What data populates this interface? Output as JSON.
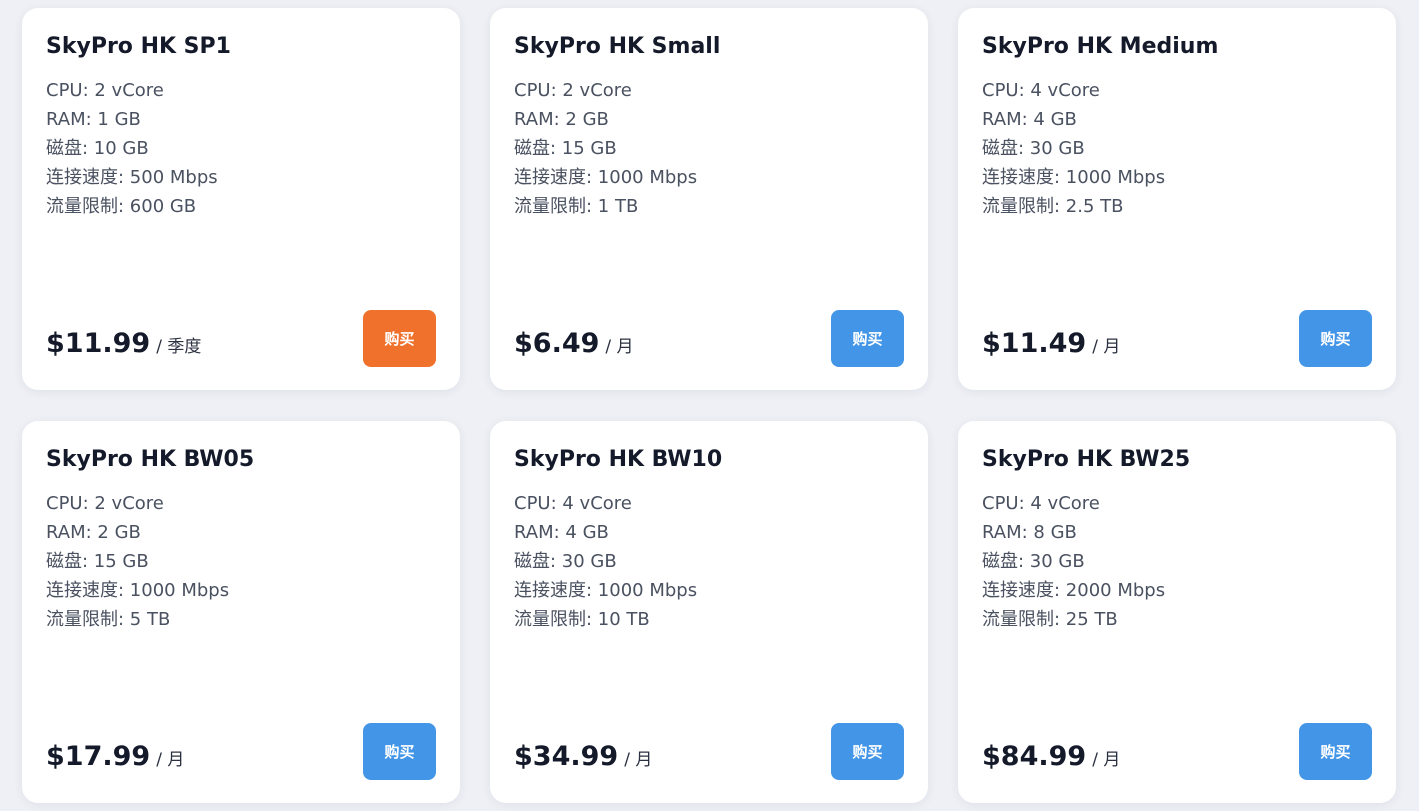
{
  "plans": [
    {
      "name": "SkyPro HK SP1",
      "cpu": "CPU: 2 vCore",
      "ram": "RAM: 1 GB",
      "disk": "磁盘: 10 GB",
      "speed": "连接速度: 500 Mbps",
      "traffic": "流量限制: 600 GB",
      "price": "$11.99",
      "period": "/ 季度",
      "buy_label": "购买",
      "button_color": "#f0712c"
    },
    {
      "name": "SkyPro HK Small",
      "cpu": "CPU: 2 vCore",
      "ram": "RAM: 2 GB",
      "disk": "磁盘: 15 GB",
      "speed": "连接速度: 1000 Mbps",
      "traffic": "流量限制: 1 TB",
      "price": "$6.49",
      "period": "/ 月",
      "buy_label": "购买",
      "button_color": "#4395e8"
    },
    {
      "name": "SkyPro HK Medium",
      "cpu": "CPU: 4 vCore",
      "ram": "RAM: 4 GB",
      "disk": "磁盘: 30 GB",
      "speed": "连接速度: 1000 Mbps",
      "traffic": "流量限制: 2.5 TB",
      "price": "$11.49",
      "period": "/ 月",
      "buy_label": "购买",
      "button_color": "#4395e8"
    },
    {
      "name": "SkyPro HK BW05",
      "cpu": "CPU: 2 vCore",
      "ram": "RAM: 2 GB",
      "disk": "磁盘: 15 GB",
      "speed": "连接速度: 1000 Mbps",
      "traffic": "流量限制: 5 TB",
      "price": "$17.99",
      "period": "/ 月",
      "buy_label": "购买",
      "button_color": "#4395e8"
    },
    {
      "name": "SkyPro HK BW10",
      "cpu": "CPU: 4 vCore",
      "ram": "RAM: 4 GB",
      "disk": "磁盘: 30 GB",
      "speed": "连接速度: 1000 Mbps",
      "traffic": "流量限制: 10 TB",
      "price": "$34.99",
      "period": "/ 月",
      "buy_label": "购买",
      "button_color": "#4395e8"
    },
    {
      "name": "SkyPro HK BW25",
      "cpu": "CPU: 4 vCore",
      "ram": "RAM: 8 GB",
      "disk": "磁盘: 30 GB",
      "speed": "连接速度: 2000 Mbps",
      "traffic": "流量限制: 25 TB",
      "price": "$84.99",
      "period": "/ 月",
      "buy_label": "购买",
      "button_color": "#4395e8"
    }
  ],
  "colors": {
    "page_background": "#eef0f5",
    "card_background": "#ffffff",
    "primary_button": "#4395e8",
    "highlight_button": "#f0712c",
    "title_text": "#141a2a",
    "spec_text": "#4a5160"
  }
}
